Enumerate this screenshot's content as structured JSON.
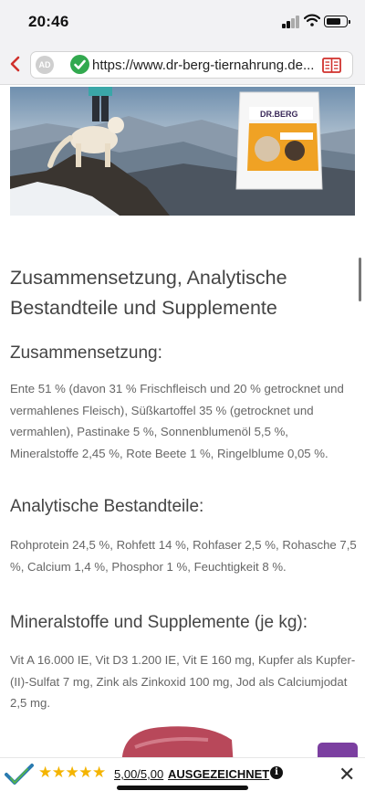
{
  "status_bar": {
    "time": "20:46"
  },
  "browser": {
    "ad_badge": "AD",
    "url": "https://www.dr-berg-tiernahrung.de..."
  },
  "hero": {
    "package_brand": "DR.BERG"
  },
  "content": {
    "title": "Zusammensetzung, Analytische Bestandteile und Supplemente",
    "sections": [
      {
        "heading": "Zusammensetzung:",
        "text": "Ente 51 % (davon 31 % Frischfleisch und 20 % getrocknet und vermahlenes Fleisch), Süßkartoffel 35 % (getrocknet und vermahlen), Pastinake 5 %, Sonnenblumenöl 5,5 %, Mineralstoffe 2,45 %, Rote Beete 1 %, Ringelblume 0,05 %."
      },
      {
        "heading": "Analytische Bestandteile:",
        "text": "Rohprotein 24,5 %, Rohfett 14 %, Rohfaser 2,5 %, Rohasche 7,5 %, Calcium 1,4 %, Phosphor 1 %, Feuchtigkeit 8 %."
      },
      {
        "heading": "Mineralstoffe und Supplemente (je kg):",
        "text": "Vit A 16.000 IE, Vit D3 1.200 IE, Vit E 160 mg, Kupfer als Kupfer-(II)-Sulfat 7 mg, Zink als Zinkoxid 100 mg, Jod als Calciumjodat 2,5 mg."
      }
    ]
  },
  "rating_bar": {
    "stars": "★★★★★",
    "score": "5,00/5,00",
    "label": "AUSGEZEICHNET",
    "info_icon": "i",
    "close_icon": "✕"
  },
  "colors": {
    "secure_green": "#32a94f",
    "back_red": "#d0312d",
    "star_gold": "#f4b400",
    "chat_purple": "#7b3fa0"
  }
}
